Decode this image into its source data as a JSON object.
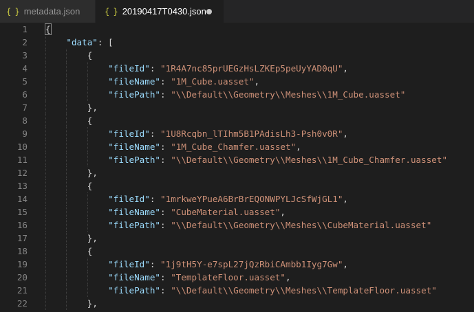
{
  "tabs": [
    {
      "icon": "{ }",
      "label": "metadata.json",
      "active": false
    },
    {
      "icon": "{ }",
      "label": "20190417T0430.json",
      "active": true,
      "unsaved": true
    }
  ],
  "lines": [
    {
      "n": "1",
      "indent": 0,
      "segs": [
        [
          "p",
          "{"
        ]
      ]
    },
    {
      "n": "2",
      "indent": 1,
      "segs": [
        [
          "k",
          "\"data\""
        ],
        [
          "p",
          ": ["
        ]
      ]
    },
    {
      "n": "3",
      "indent": 2,
      "segs": [
        [
          "p",
          "{"
        ]
      ]
    },
    {
      "n": "4",
      "indent": 3,
      "segs": [
        [
          "k",
          "\"fileId\""
        ],
        [
          "p",
          ": "
        ],
        [
          "s",
          "\"1R4A7nc85prUEGzHsLZKEp5peUyYAD0qU\""
        ],
        [
          "p",
          ","
        ]
      ]
    },
    {
      "n": "5",
      "indent": 3,
      "segs": [
        [
          "k",
          "\"fileName\""
        ],
        [
          "p",
          ": "
        ],
        [
          "s",
          "\"1M_Cube.uasset\""
        ],
        [
          "p",
          ","
        ]
      ]
    },
    {
      "n": "6",
      "indent": 3,
      "segs": [
        [
          "k",
          "\"filePath\""
        ],
        [
          "p",
          ": "
        ],
        [
          "s",
          "\"\\\\Default\\\\Geometry\\\\Meshes\\\\1M_Cube.uasset\""
        ]
      ]
    },
    {
      "n": "7",
      "indent": 2,
      "segs": [
        [
          "p",
          "},"
        ]
      ]
    },
    {
      "n": "8",
      "indent": 2,
      "segs": [
        [
          "p",
          "{"
        ]
      ]
    },
    {
      "n": "9",
      "indent": 3,
      "segs": [
        [
          "k",
          "\"fileId\""
        ],
        [
          "p",
          ": "
        ],
        [
          "s",
          "\"1U8Rcqbn_lTIhm5B1PAdisLh3-Psh0v0R\""
        ],
        [
          "p",
          ","
        ]
      ]
    },
    {
      "n": "10",
      "indent": 3,
      "segs": [
        [
          "k",
          "\"fileName\""
        ],
        [
          "p",
          ": "
        ],
        [
          "s",
          "\"1M_Cube_Chamfer.uasset\""
        ],
        [
          "p",
          ","
        ]
      ]
    },
    {
      "n": "11",
      "indent": 3,
      "segs": [
        [
          "k",
          "\"filePath\""
        ],
        [
          "p",
          ": "
        ],
        [
          "s",
          "\"\\\\Default\\\\Geometry\\\\Meshes\\\\1M_Cube_Chamfer.uasset\""
        ]
      ]
    },
    {
      "n": "12",
      "indent": 2,
      "segs": [
        [
          "p",
          "},"
        ]
      ]
    },
    {
      "n": "13",
      "indent": 2,
      "segs": [
        [
          "p",
          "{"
        ]
      ]
    },
    {
      "n": "14",
      "indent": 3,
      "segs": [
        [
          "k",
          "\"fileId\""
        ],
        [
          "p",
          ": "
        ],
        [
          "s",
          "\"1mrkweYPueA6BrBrEQONWPYLJcSfWjGL1\""
        ],
        [
          "p",
          ","
        ]
      ]
    },
    {
      "n": "15",
      "indent": 3,
      "segs": [
        [
          "k",
          "\"fileName\""
        ],
        [
          "p",
          ": "
        ],
        [
          "s",
          "\"CubeMaterial.uasset\""
        ],
        [
          "p",
          ","
        ]
      ]
    },
    {
      "n": "16",
      "indent": 3,
      "segs": [
        [
          "k",
          "\"filePath\""
        ],
        [
          "p",
          ": "
        ],
        [
          "s",
          "\"\\\\Default\\\\Geometry\\\\Meshes\\\\CubeMaterial.uasset\""
        ]
      ]
    },
    {
      "n": "17",
      "indent": 2,
      "segs": [
        [
          "p",
          "},"
        ]
      ]
    },
    {
      "n": "18",
      "indent": 2,
      "segs": [
        [
          "p",
          "{"
        ]
      ]
    },
    {
      "n": "19",
      "indent": 3,
      "segs": [
        [
          "k",
          "\"fileId\""
        ],
        [
          "p",
          ": "
        ],
        [
          "s",
          "\"1j9tH5Y-e7spL27jQzRbiCAmbb1Iyg7Gw\""
        ],
        [
          "p",
          ","
        ]
      ]
    },
    {
      "n": "20",
      "indent": 3,
      "segs": [
        [
          "k",
          "\"fileName\""
        ],
        [
          "p",
          ": "
        ],
        [
          "s",
          "\"TemplateFloor.uasset\""
        ],
        [
          "p",
          ","
        ]
      ]
    },
    {
      "n": "21",
      "indent": 3,
      "segs": [
        [
          "k",
          "\"filePath\""
        ],
        [
          "p",
          ": "
        ],
        [
          "s",
          "\"\\\\Default\\\\Geometry\\\\Meshes\\\\TemplateFloor.uasset\""
        ]
      ]
    },
    {
      "n": "22",
      "indent": 2,
      "segs": [
        [
          "p",
          "},"
        ]
      ]
    }
  ]
}
